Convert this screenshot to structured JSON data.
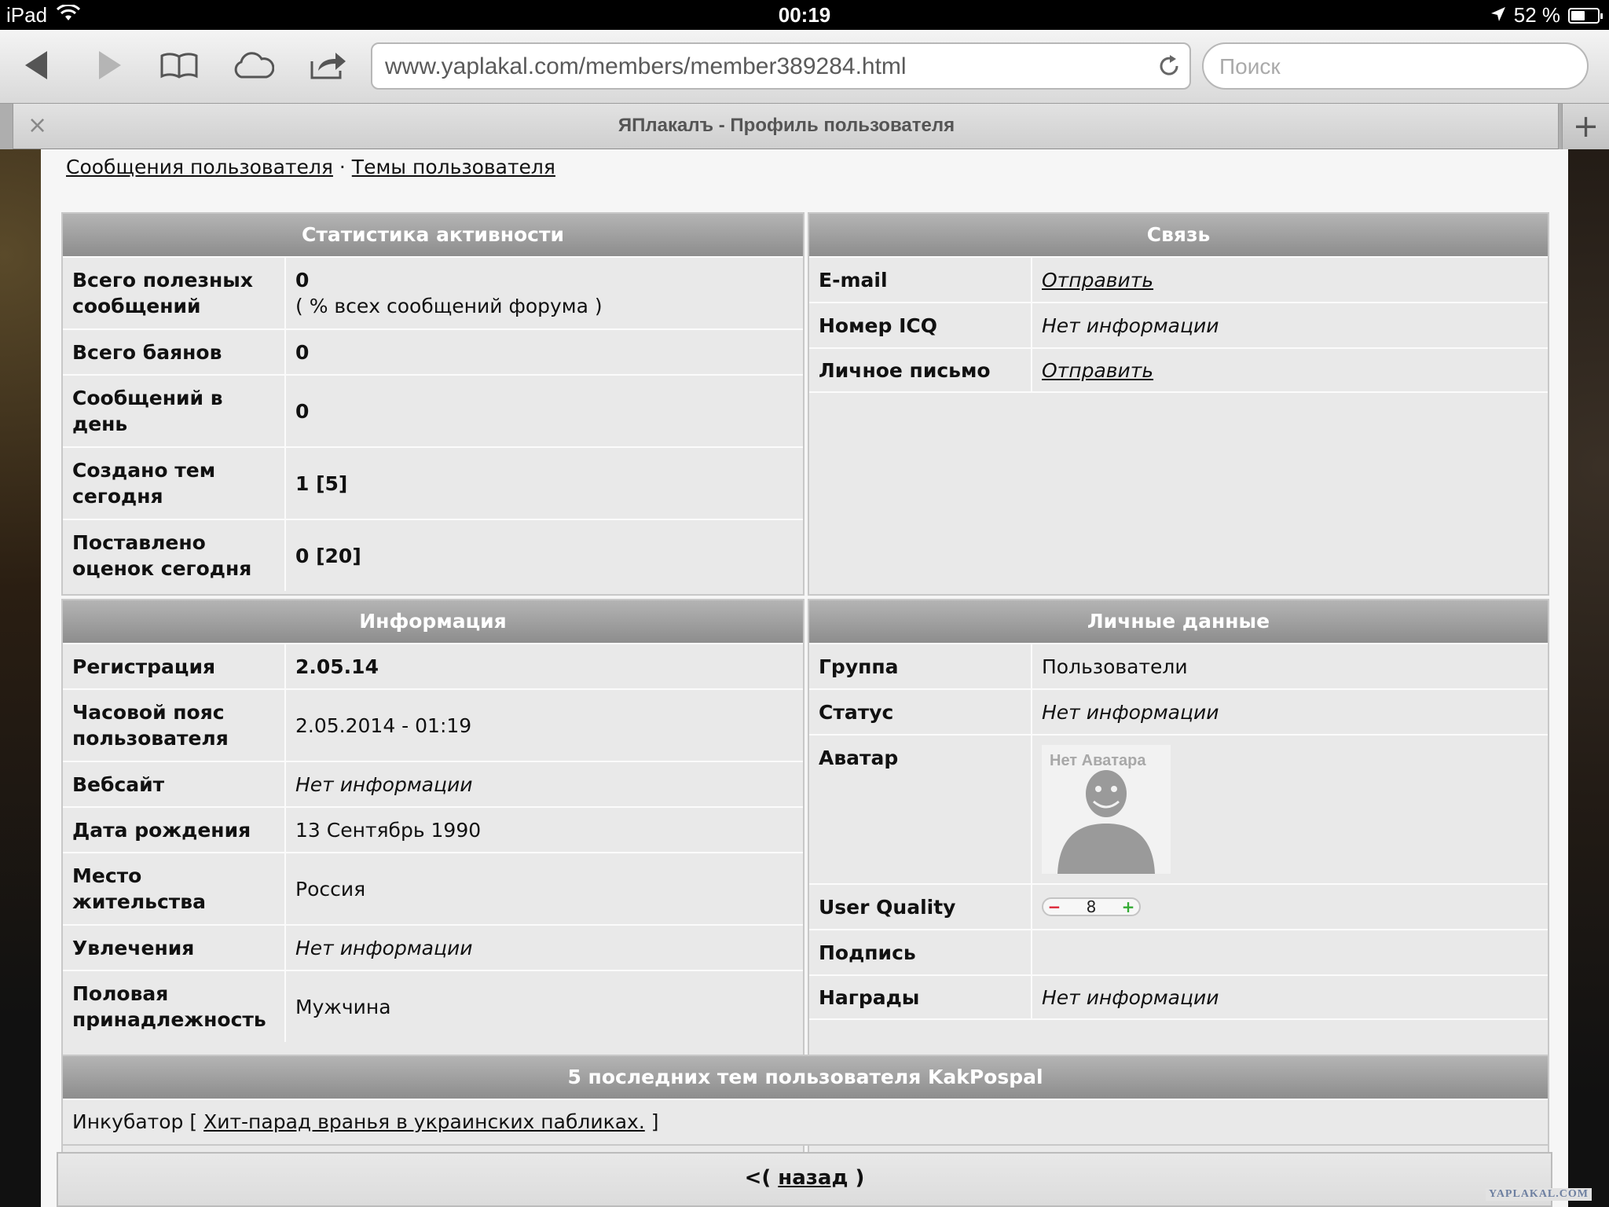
{
  "status_bar": {
    "device": "iPad",
    "time": "00:19",
    "battery": "52 %",
    "battery_level": 0.52
  },
  "toolbar": {
    "url": "www.yaplakal.com/members/member389284.html",
    "search_placeholder": "Поиск"
  },
  "tab": {
    "title": "ЯПлакалъ - Профиль пользователя",
    "close": "×",
    "new_tab": "+"
  },
  "profile_links": {
    "messages": "Сообщения пользователя",
    "separator": "·",
    "topics": "Темы пользователя"
  },
  "activity": {
    "title": "Статистика активности",
    "rows": [
      {
        "label": "Всего полезных сообщений",
        "value": "0",
        "note": "( % всех сообщений форума )"
      },
      {
        "label": "Всего баянов",
        "value": "0"
      },
      {
        "label": "Сообщений в день",
        "value": "0"
      },
      {
        "label": "Создано тем сегодня",
        "value": "1 [5]"
      },
      {
        "label": "Поставлено оценок сегодня",
        "value": "0 [20]"
      }
    ]
  },
  "contact": {
    "title": "Связь",
    "rows": [
      {
        "label": "E-mail",
        "value": "Отправить"
      },
      {
        "label": "Номер ICQ",
        "value": "Нет информации"
      },
      {
        "label": "Личное письмо",
        "value": "Отправить"
      }
    ]
  },
  "info": {
    "title": "Информация",
    "rows": [
      {
        "label": "Регистрация",
        "value": "2.05.14"
      },
      {
        "label": "Часовой пояс пользователя",
        "value": "2.05.2014 - 01:19"
      },
      {
        "label": "Вебсайт",
        "value": "Нет информации"
      },
      {
        "label": "Дата рождения",
        "value": "13 Сентябрь 1990"
      },
      {
        "label": "Место жительства",
        "value": "Россия"
      },
      {
        "label": "Увлечения",
        "value": "Нет информации"
      },
      {
        "label": "Половая принадлежность",
        "value": "Мужчина"
      }
    ]
  },
  "personal": {
    "title": "Личные данные",
    "rows": [
      {
        "label": "Группа",
        "value": "Пользователи"
      },
      {
        "label": "Статус",
        "value": "Нет информации"
      },
      {
        "label": "Аватар",
        "value": "Нет Аватара"
      },
      {
        "label": "User Quality",
        "value": "8",
        "minus": "−",
        "plus": "+"
      },
      {
        "label": "Подпись",
        "value": ""
      },
      {
        "label": "Награды",
        "value": "Нет информации"
      }
    ]
  },
  "recent_topics": {
    "title": "5 последних тем пользователя KakPospal",
    "items": [
      {
        "forum": "Инкубатор",
        "open": "[",
        "topic": "Хит-парад вранья в украинских пабликах.",
        "close": "]"
      }
    ]
  },
  "back": {
    "prefix": "<(",
    "link": "назад",
    "suffix": ")"
  },
  "watermark": "YAPLAKAL.COM",
  "colors": {
    "header_gradient_top": "#b4b4b4",
    "header_gradient_bottom": "#8d8d8d",
    "panel_bg": "#e9e9e9"
  }
}
